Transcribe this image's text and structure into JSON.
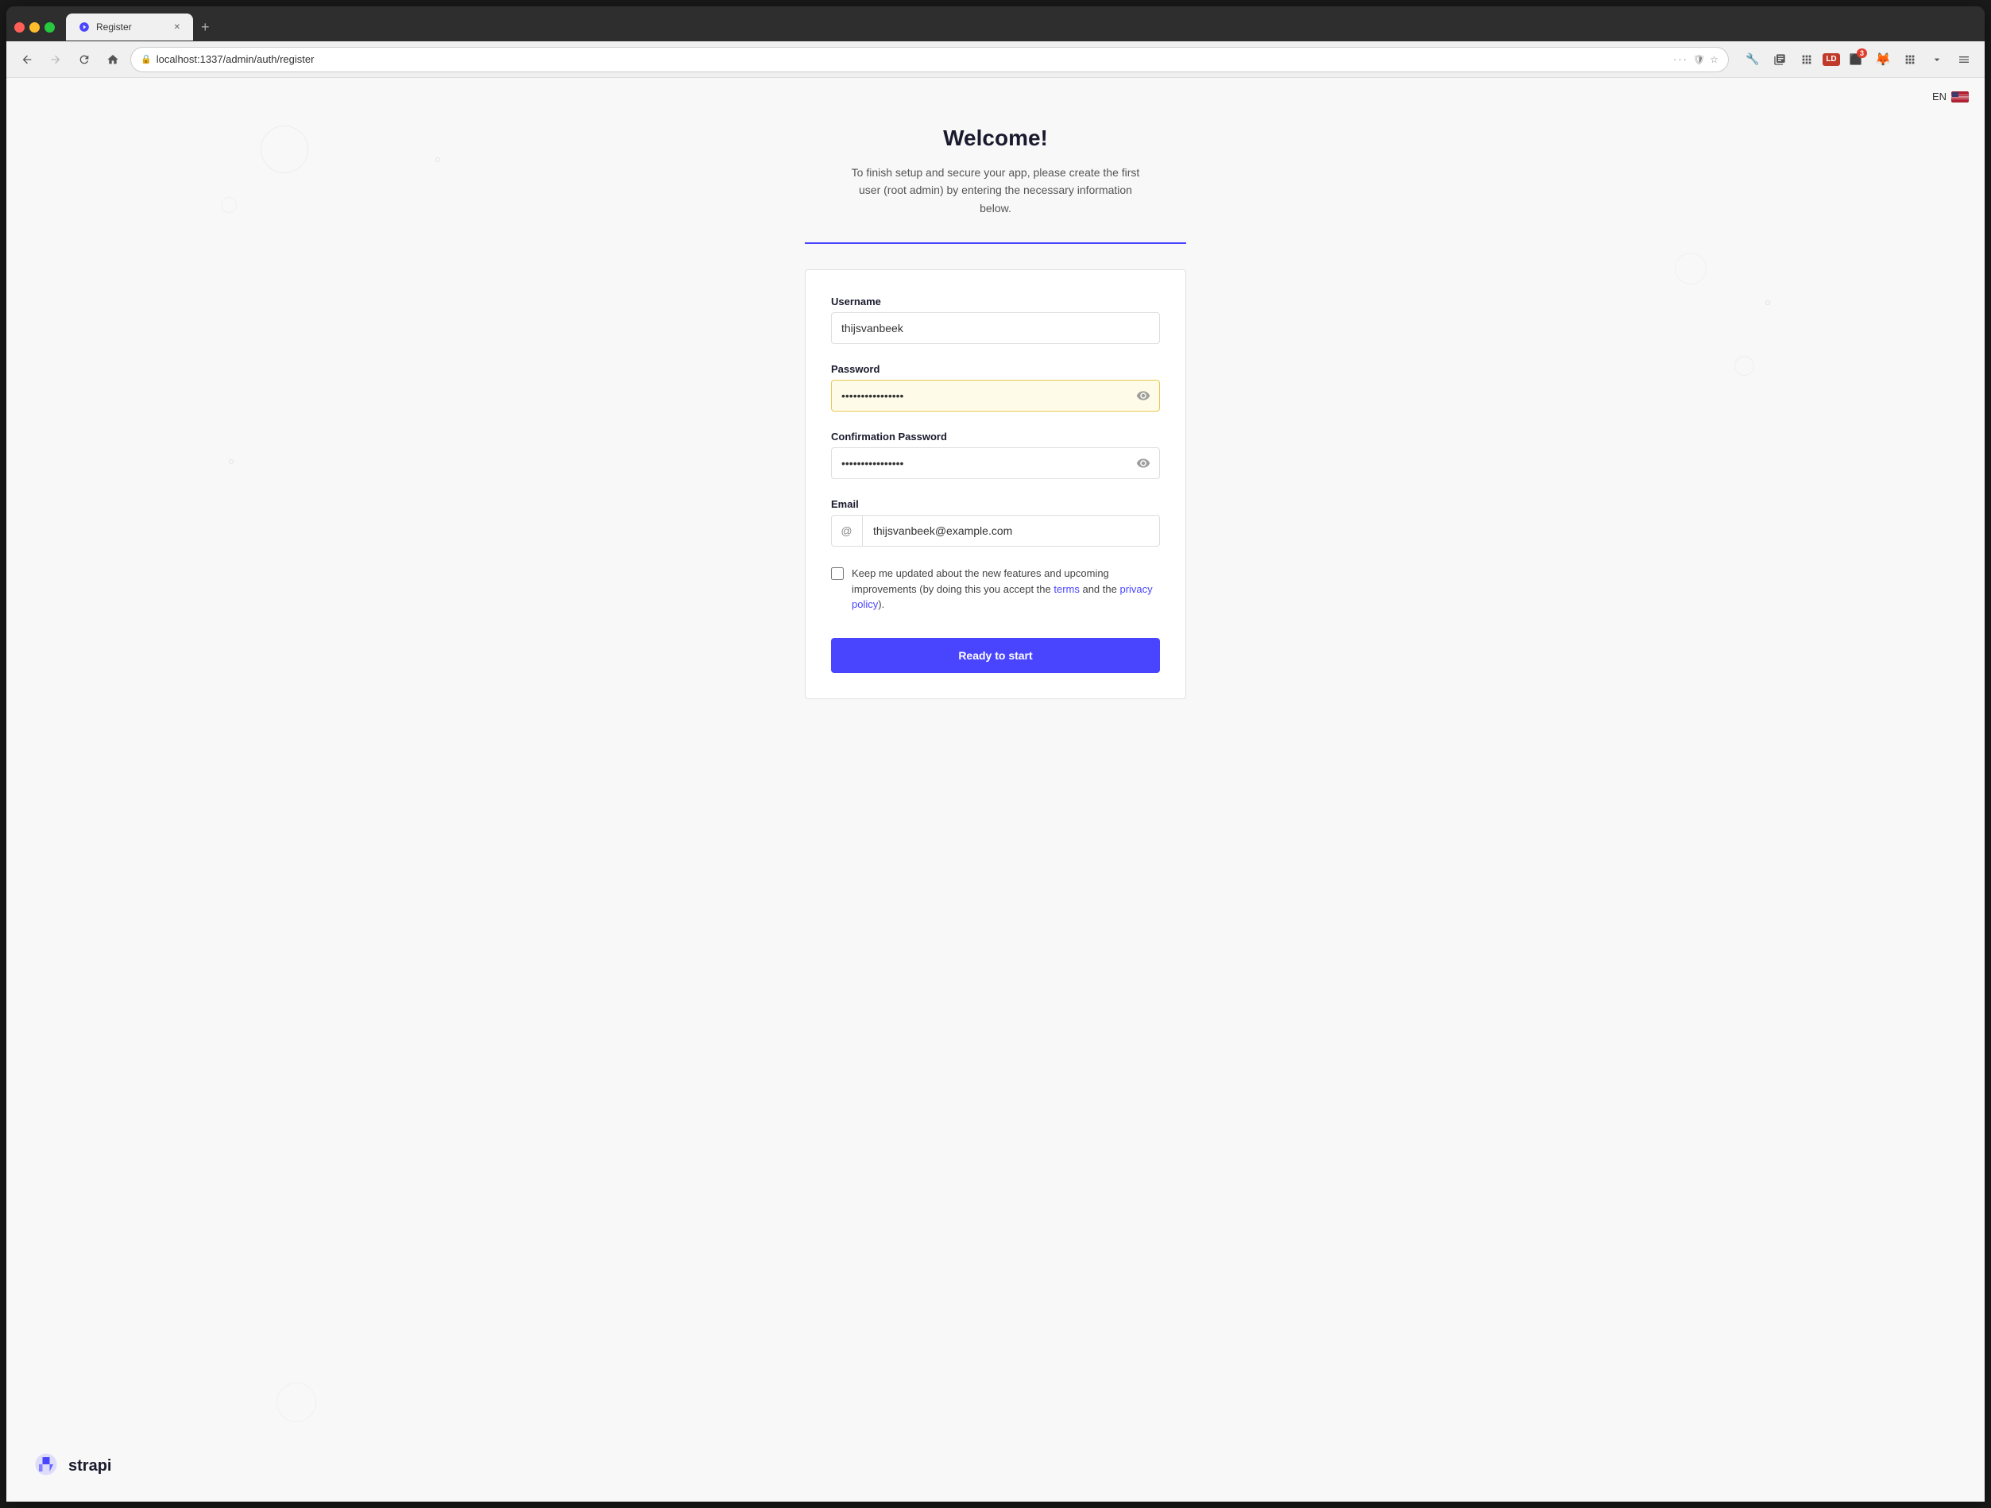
{
  "browser": {
    "tab_title": "Register",
    "url": "localhost:1337/admin/auth/register",
    "back_disabled": false,
    "forward_disabled": true
  },
  "lang": {
    "code": "EN"
  },
  "page": {
    "title": "Welcome!",
    "subtitle": "To finish setup and secure your app, please create the first user (root admin) by entering the necessary information below."
  },
  "form": {
    "username_label": "Username",
    "username_value": "thijsvanbeek",
    "username_placeholder": "thijsvanbeek",
    "password_label": "Password",
    "password_value": "••••••••••••••••",
    "confirm_password_label": "Confirmation Password",
    "confirm_password_value": "••••••••••••••",
    "email_label": "Email",
    "email_value": "thijsvanbeek@example.com",
    "email_placeholder": "thijsvanbeek@example.com",
    "checkbox_label": "Keep me updated about the new features and upcoming improvements (by doing this you accept the ",
    "terms_link": "terms",
    "and_text": " and the ",
    "privacy_link": "privacy policy",
    "period": ").",
    "submit_label": "Ready to start"
  },
  "strapi": {
    "name": "strapi"
  }
}
